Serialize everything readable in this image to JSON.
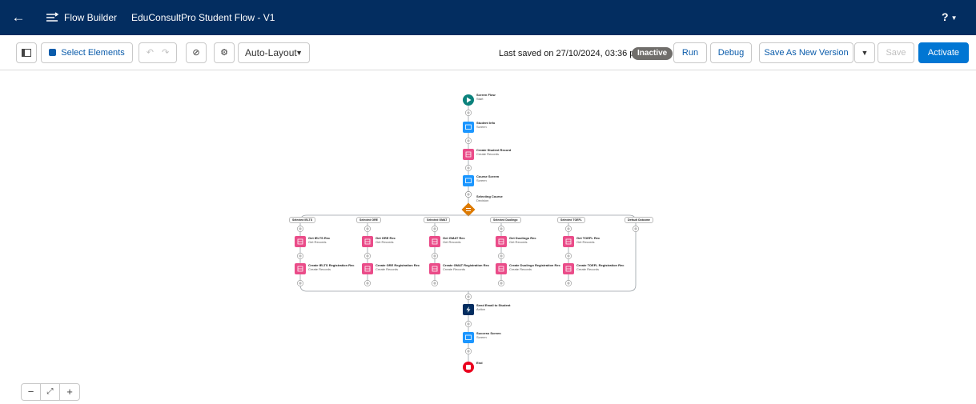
{
  "header": {
    "app_name": "Flow Builder",
    "flow_name": "EduConsultPro Student Flow - V1",
    "help": "?"
  },
  "toolbar": {
    "select_elements": "Select Elements",
    "layout": "Auto-Layout",
    "last_saved": "Last saved on 27/10/2024, 03:36 pm",
    "status": "Inactive",
    "run": "Run",
    "debug": "Debug",
    "save_as_new": "Save As New Version",
    "save": "Save",
    "activate": "Activate"
  },
  "flow": {
    "start": {
      "title": "Screen Flow",
      "sub": "Start"
    },
    "main": [
      {
        "title": "Student Info",
        "sub": "Screen",
        "kind": "screen"
      },
      {
        "title": "Create Student Record",
        "sub": "Create Records",
        "kind": "data"
      },
      {
        "title": "Course Screen",
        "sub": "Screen",
        "kind": "screen"
      }
    ],
    "decision": {
      "title": "Selecting Course",
      "sub": "Decision"
    },
    "branches": [
      {
        "label": "Selected IELTS",
        "get": "Get IELTS Rec",
        "create": "Create IELTS Registration Rec"
      },
      {
        "label": "Selected GRE",
        "get": "Get GRE Rec",
        "create": "Create GRE Registration Rec"
      },
      {
        "label": "Selected GMAT",
        "get": "Get GMAT Rec",
        "create": "Create GMAT Registration Rec"
      },
      {
        "label": "Selected Duolingo",
        "get": "Get Duolingo Rec",
        "create": "Create Duolingo Registration Rec"
      },
      {
        "label": "Selected TOEFL",
        "get": "Get TOEFL Rec",
        "create": "Create TOEFL Registration Rec"
      },
      {
        "label": "Default Outcome",
        "get": "",
        "create": ""
      }
    ],
    "get_sub": "Get Records",
    "create_sub": "Create Records",
    "after": [
      {
        "title": "Send Email to Student",
        "sub": "Action",
        "kind": "action"
      },
      {
        "title": "Success Screen",
        "sub": "Screen",
        "kind": "screen"
      }
    ],
    "end": {
      "title": "End"
    }
  },
  "colors": {
    "header": "#032d60",
    "accent": "#0176d3",
    "start": "#0b827c",
    "screen": "#1b96ff",
    "data": "#ea4c89",
    "decision": "#dd7a01",
    "action": "#032d60",
    "end": "#ea001e"
  },
  "zoom": {
    "minus": "−",
    "plus": "+"
  }
}
